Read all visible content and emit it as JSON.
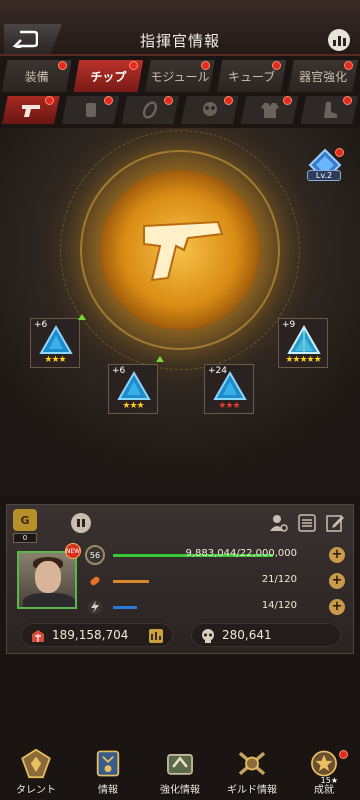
{
  "header": {
    "title": "指揮官情報"
  },
  "tabs": [
    {
      "label": "装備",
      "active": false,
      "badge": true
    },
    {
      "label": "チップ",
      "active": true,
      "badge": true
    },
    {
      "label": "モジュール",
      "active": false,
      "badge": true
    },
    {
      "label": "キューブ",
      "active": false,
      "badge": true
    },
    {
      "label": "器官強化",
      "active": false,
      "badge": true
    }
  ],
  "subtabs": [
    {
      "icon": "pistol-icon",
      "active": true
    },
    {
      "icon": "ammo-box-icon",
      "active": false
    },
    {
      "icon": "rifle-icon",
      "active": false
    },
    {
      "icon": "gas-mask-icon",
      "active": false
    },
    {
      "icon": "armor-vest-icon",
      "active": false
    },
    {
      "icon": "boot-icon",
      "active": false
    }
  ],
  "stage": {
    "level_badge": "Lv.2",
    "chips": [
      {
        "plus": "+6",
        "stars": 3,
        "star_color": "#ffcc22",
        "upgrade": true,
        "name": "chip-slot-1"
      },
      {
        "plus": "+6",
        "stars": 3,
        "star_color": "#ffcc22",
        "upgrade": true,
        "name": "chip-slot-2"
      },
      {
        "plus": "+24",
        "stars": 3,
        "star_color": "#e83a2a",
        "upgrade": false,
        "name": "chip-slot-3"
      },
      {
        "plus": "+9",
        "stars": 5,
        "star_color": "#ffcc22",
        "upgrade": false,
        "name": "chip-slot-4"
      }
    ]
  },
  "commander": {
    "rank_letter": "G",
    "rank_count": "0",
    "new_badge": "NEW",
    "level": "56",
    "exp": "9,883,044/22,000,000",
    "exp_fraction": 0.449,
    "stamina": "21/120",
    "energy": "14/120",
    "power": "189,158,704",
    "kills": "280,641"
  },
  "bottom_nav": [
    {
      "label": "タレント",
      "icon": "talent-icon"
    },
    {
      "label": "情報",
      "icon": "info-medal-icon"
    },
    {
      "label": "強化情報",
      "icon": "enhance-icon"
    },
    {
      "label": "ギルド情報",
      "icon": "guild-icon"
    },
    {
      "label": "成就",
      "icon": "achievement-icon",
      "star": "15★",
      "badge": true
    }
  ],
  "colors": {
    "accent_red": "#b9322a",
    "gold": "#f0a020",
    "exp_bar": "#3ac83a",
    "stamina_bar": "#d8882a",
    "energy_bar": "#2a7ad8"
  }
}
